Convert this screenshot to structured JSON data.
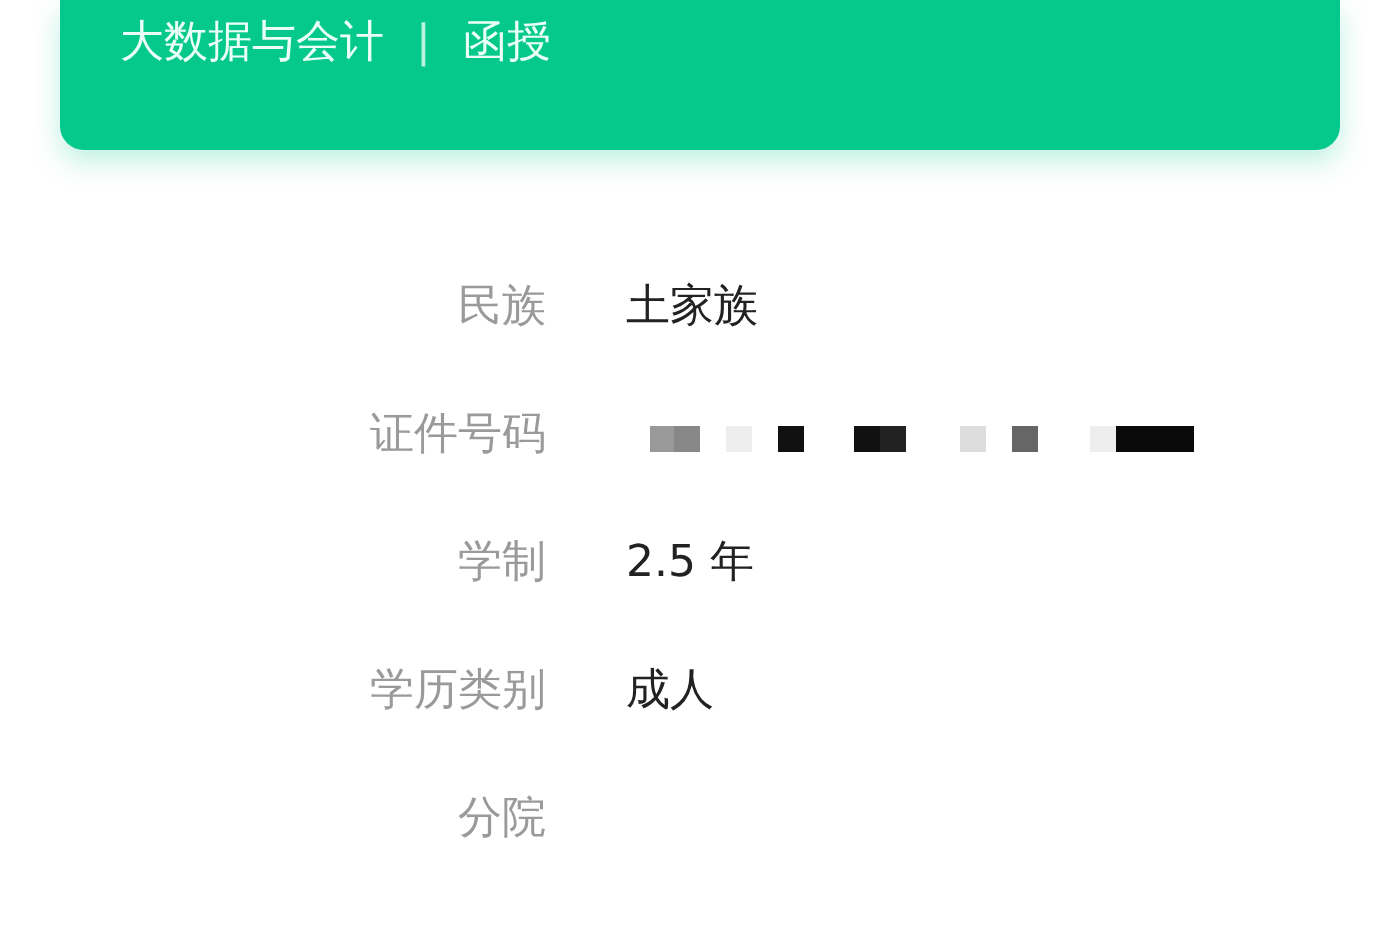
{
  "header": {
    "major": "大数据与会计",
    "separator": "|",
    "study_mode": "函授"
  },
  "fields": [
    {
      "label": "民族",
      "kind": "text",
      "value": "土家族"
    },
    {
      "label": "证件号码",
      "kind": "redacted"
    },
    {
      "label": "学制",
      "kind": "text",
      "value": "2.5 年"
    },
    {
      "label": "学历类别",
      "kind": "text",
      "value": "成人"
    },
    {
      "label": "分院",
      "kind": "text"
    }
  ]
}
